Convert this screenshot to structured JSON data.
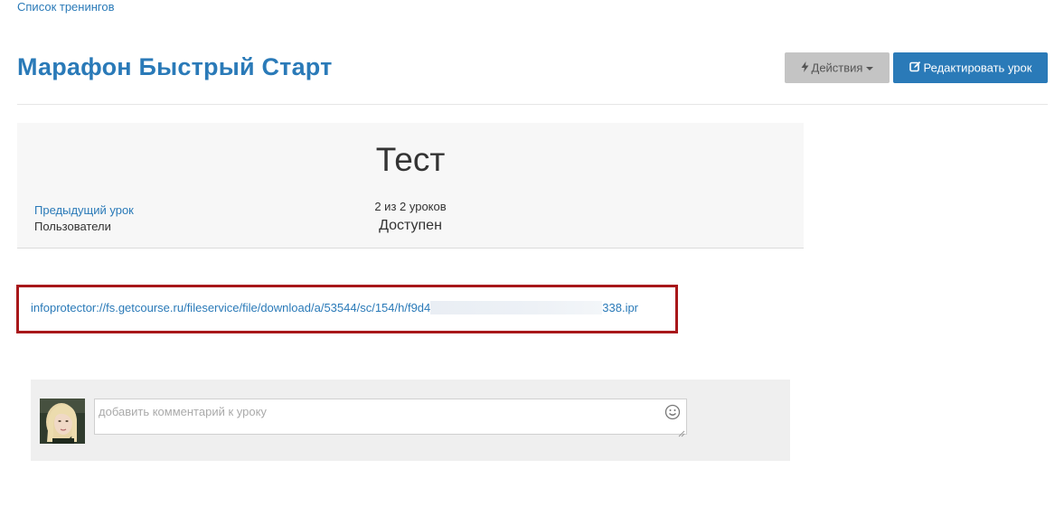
{
  "breadcrumb": {
    "label": "Список тренингов"
  },
  "header": {
    "title": "Марафон Быстрый Старт",
    "actions_label": "Действия",
    "edit_label": "Редактировать урок"
  },
  "lesson": {
    "title": "Тест",
    "prev_link": "Предыдущий урок",
    "users_label": "Пользователи",
    "counter": "2 из 2 уроков",
    "status": "Доступен"
  },
  "download": {
    "link_prefix": "infoprotector://fs.getcourse.ru/fileservice/file/download/a/53544/sc/154/h/f9d4",
    "link_suffix": "338.ipr",
    "highlight_color": "#a8171a"
  },
  "comment": {
    "placeholder": "добавить комментарий к уроку",
    "emoji_icon": "smiley-icon"
  },
  "colors": {
    "accent": "#2a7ab8",
    "actions_bg": "#c4c4c4"
  }
}
